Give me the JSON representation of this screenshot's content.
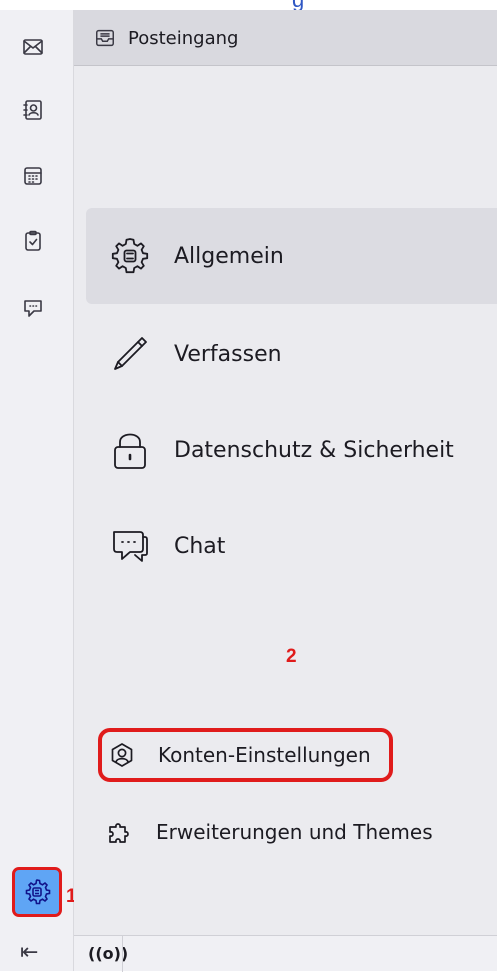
{
  "window": {
    "title_fragment": "g"
  },
  "spaces": {
    "items": [
      {
        "name": "mail",
        "icon": "mail-icon"
      },
      {
        "name": "address-book",
        "icon": "address-book-icon"
      },
      {
        "name": "calendar",
        "icon": "calendar-icon"
      },
      {
        "name": "tasks",
        "icon": "tasks-icon"
      },
      {
        "name": "chat",
        "icon": "chat-icon"
      }
    ],
    "settings_icon": "gear-icon",
    "collapse_glyph": "⇤"
  },
  "tab": {
    "label": "Posteingang",
    "icon": "inbox-icon"
  },
  "categories": [
    {
      "label": "Allgemein",
      "icon": "gear-icon",
      "selected": true
    },
    {
      "label": "Verfassen",
      "icon": "pencil-icon",
      "selected": false
    },
    {
      "label": "Datenschutz & Sicherheit",
      "icon": "lock-icon",
      "selected": false
    },
    {
      "label": "Chat",
      "icon": "chat-icon",
      "selected": false
    }
  ],
  "links": {
    "account_settings": "Konten-Einstellungen",
    "addons": "Erweiterungen und Themes"
  },
  "markers": {
    "one": "1",
    "two": "2"
  },
  "statusbar": {
    "activity_glyph": "((o))"
  },
  "colors": {
    "highlight_border": "#e01b1b",
    "settings_bg": "#5fa5f5",
    "selected_bg": "#dcdce2"
  }
}
